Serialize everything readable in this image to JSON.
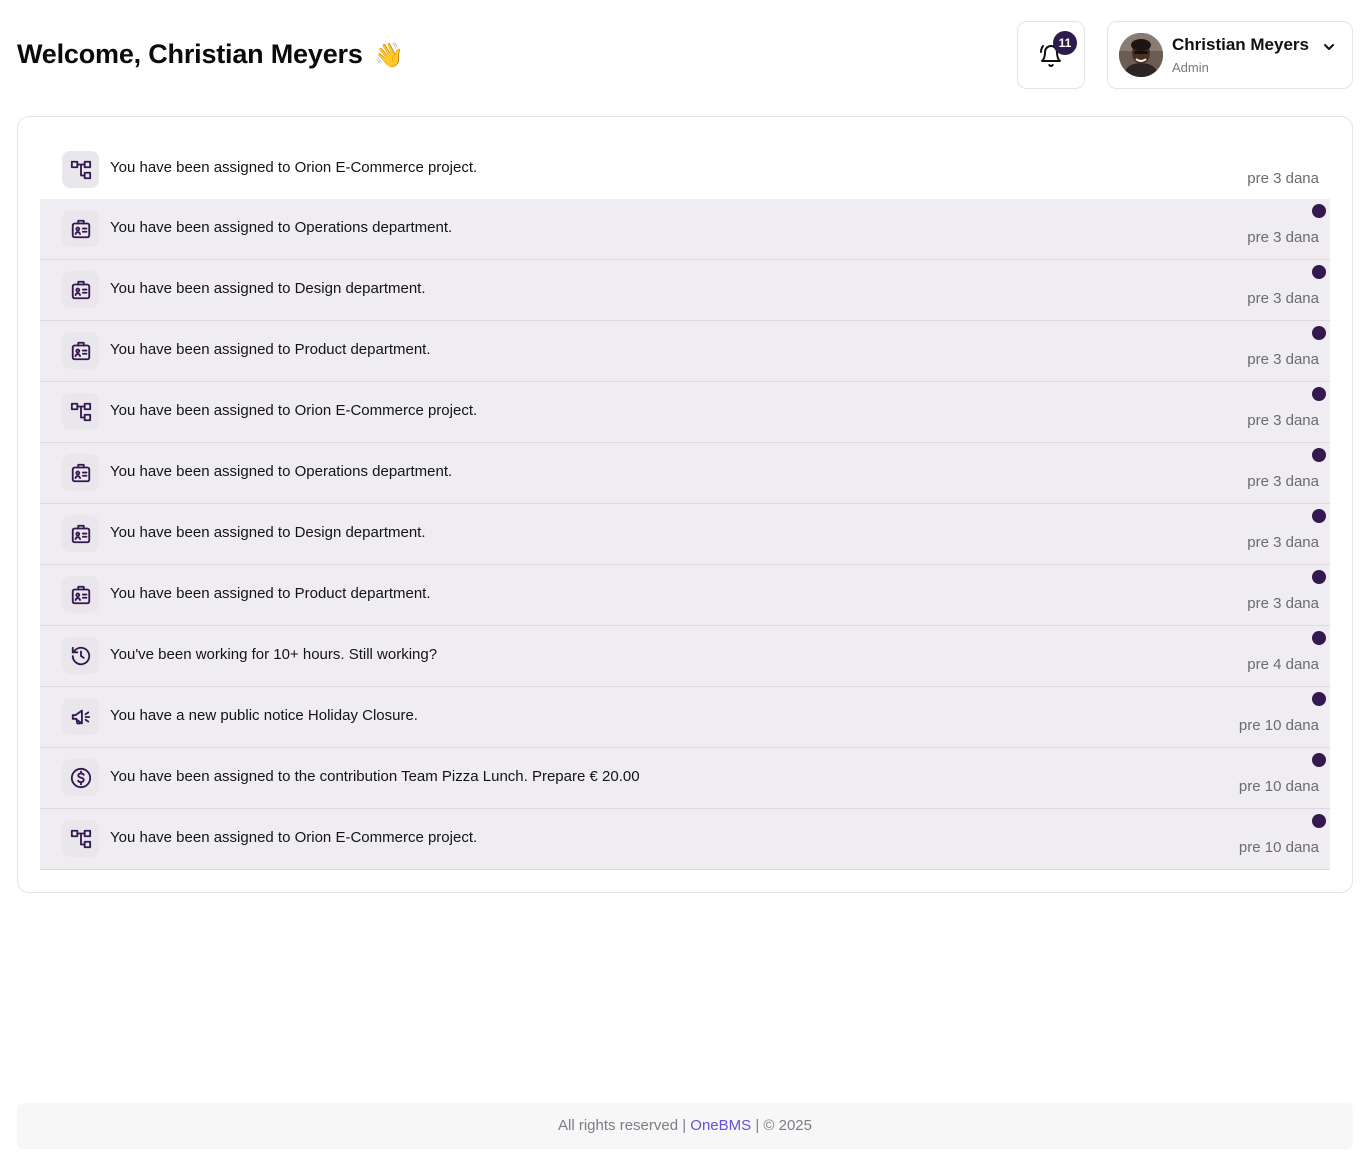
{
  "header": {
    "welcome": "Welcome, Christian Meyers",
    "wave": "👋",
    "notifications_count": "11",
    "user_name": "Christian Meyers",
    "user_role": "Admin"
  },
  "notifications": [
    {
      "icon": "project-icon",
      "text": "You have been assigned to Orion E-Commerce project.",
      "time": "pre 3 dana",
      "unread": false
    },
    {
      "icon": "department-icon",
      "text": "You have been assigned to Operations department.",
      "time": "pre 3 dana",
      "unread": true
    },
    {
      "icon": "department-icon",
      "text": "You have been assigned to Design department.",
      "time": "pre 3 dana",
      "unread": true
    },
    {
      "icon": "department-icon",
      "text": "You have been assigned to Product department.",
      "time": "pre 3 dana",
      "unread": true
    },
    {
      "icon": "project-icon",
      "text": "You have been assigned to Orion E-Commerce project.",
      "time": "pre 3 dana",
      "unread": true
    },
    {
      "icon": "department-icon",
      "text": "You have been assigned to Operations department.",
      "time": "pre 3 dana",
      "unread": true
    },
    {
      "icon": "department-icon",
      "text": "You have been assigned to Design department.",
      "time": "pre 3 dana",
      "unread": true
    },
    {
      "icon": "department-icon",
      "text": "You have been assigned to Product department.",
      "time": "pre 3 dana",
      "unread": true
    },
    {
      "icon": "history-icon",
      "text": "You've been working for 10+ hours. Still working?",
      "time": "pre 4 dana",
      "unread": true
    },
    {
      "icon": "megaphone-icon",
      "text": "You have a new public notice Holiday Closure.",
      "time": "pre 10 dana",
      "unread": true
    },
    {
      "icon": "dollar-icon",
      "text": "You have been assigned to the contribution Team Pizza Lunch. Prepare € 20.00",
      "time": "pre 10 dana",
      "unread": true
    },
    {
      "icon": "project-icon",
      "text": "You have been assigned to Orion E-Commerce project.",
      "time": "pre 10 dana",
      "unread": true
    }
  ],
  "footer": {
    "prefix": "All rights reserved |",
    "brand": "OneBMS",
    "suffix": "| © 2025"
  },
  "colors": {
    "accent": "#33194f",
    "unread_bg": "#efedf1",
    "brand_link": "#6a4fd9"
  }
}
